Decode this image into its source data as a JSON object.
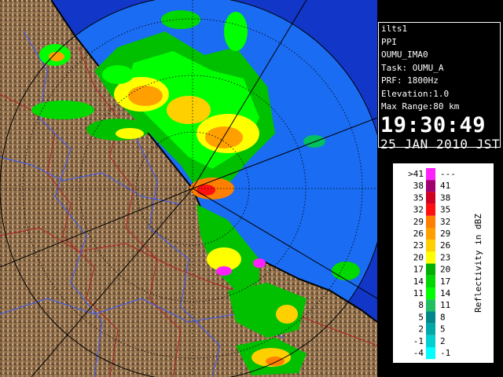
{
  "station": {
    "name": "ilts1",
    "product": "PPI",
    "site": "OUMU_IMA0",
    "task": "Task: OUMU_A",
    "prf": "PRF: 1800Hz",
    "elevation": "Elevation:1.0",
    "max_range": "Max Range:80 km",
    "time": "19:30:49",
    "date": "25 JAN 2010 JST"
  },
  "legend": {
    "title": "Reflectivity in dBZ",
    "bins": [
      {
        "low": ">41",
        "high": "---",
        "color": "#ff20ff"
      },
      {
        "low": "38",
        "high": "41",
        "color": "#a00070"
      },
      {
        "low": "35",
        "high": "38",
        "color": "#d00020"
      },
      {
        "low": "32",
        "high": "35",
        "color": "#ff1010"
      },
      {
        "low": "29",
        "high": "32",
        "color": "#ff8000"
      },
      {
        "low": "26",
        "high": "29",
        "color": "#ffa000"
      },
      {
        "low": "23",
        "high": "26",
        "color": "#ffd000"
      },
      {
        "low": "20",
        "high": "23",
        "color": "#ffff00"
      },
      {
        "low": "17",
        "high": "20",
        "color": "#00b000"
      },
      {
        "low": "14",
        "high": "17",
        "color": "#00d800"
      },
      {
        "low": "11",
        "high": "14",
        "color": "#00ff00"
      },
      {
        "low": "8",
        "high": "11",
        "color": "#20c060"
      },
      {
        "low": "5",
        "high": "8",
        "color": "#008888"
      },
      {
        "low": "2",
        "high": "5",
        "color": "#00a8a8"
      },
      {
        "low": "-1",
        "high": "2",
        "color": "#00d0d0"
      },
      {
        "low": "-4",
        "high": "-1",
        "color": "#00ffff"
      }
    ]
  },
  "colors": {
    "sea": "#1a6cf2",
    "sea_outer": "#1236c8",
    "land": "#8a6a48",
    "coast": "#000000",
    "river": "#3a5aff",
    "border": "#b22222"
  }
}
